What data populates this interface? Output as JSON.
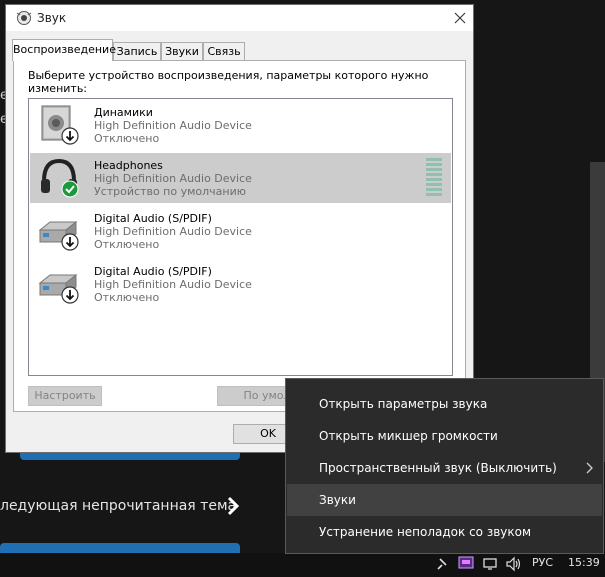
{
  "background": {
    "next_topic": "ледующая непрочитанная тема",
    "edge_text": [
      "е",
      "е"
    ]
  },
  "dialog": {
    "title": "Звук",
    "tabs": [
      {
        "label": "Воспроизведение",
        "active": true
      },
      {
        "label": "Запись",
        "active": false
      },
      {
        "label": "Звуки",
        "active": false
      },
      {
        "label": "Связь",
        "active": false
      }
    ],
    "instruction": "Выберите устройство воспроизведения, параметры которого нужно изменить:",
    "devices": [
      {
        "name": "Динамики",
        "driver": "High Definition Audio Device",
        "status": "Отключено",
        "icon": "speaker-icon",
        "selected": false
      },
      {
        "name": "Headphones",
        "driver": "High Definition Audio Device",
        "status": "Устройство по умолчанию",
        "icon": "headphones-icon",
        "selected": true
      },
      {
        "name": "Digital Audio (S/PDIF)",
        "driver": "High Definition Audio Device",
        "status": "Отключено",
        "icon": "digital-audio-icon",
        "selected": false
      },
      {
        "name": "Digital Audio (S/PDIF)",
        "driver": "High Definition Audio Device",
        "status": "Отключено",
        "icon": "digital-audio-icon",
        "selected": false
      }
    ],
    "buttons": {
      "configure": "Настроить",
      "set_default": "По умол",
      "ok": "OK"
    }
  },
  "context_menu": {
    "items": [
      {
        "label": "Открыть параметры звука",
        "submenu": false
      },
      {
        "label": "Открыть микшер громкости",
        "submenu": false
      },
      {
        "label": "Пространственный звук (Выключить)",
        "submenu": true
      },
      {
        "label": "Звуки",
        "submenu": false,
        "highlighted": true
      },
      {
        "label": "Устранение неполадок со звуком",
        "submenu": false
      }
    ]
  },
  "taskbar": {
    "language": "РУС",
    "time": "15:39"
  },
  "colors": {
    "selection": "#cccccc",
    "menu_bg": "#2b2b2b",
    "menu_hover": "#414141",
    "accent_blue": "#1f6fb2",
    "check_green": "#1a9a3a"
  }
}
